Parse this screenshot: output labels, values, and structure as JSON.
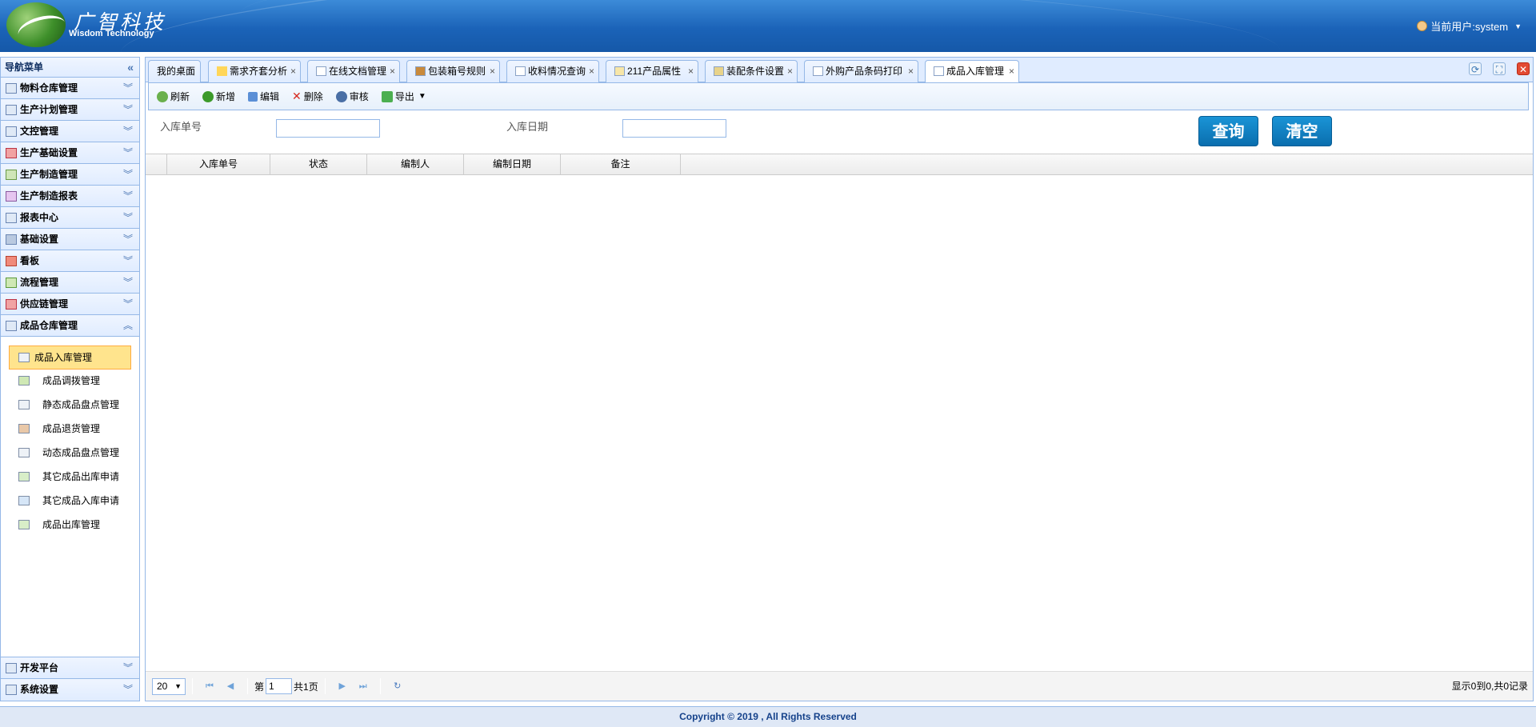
{
  "header": {
    "logo_cn": "广智科技",
    "logo_en": "Wisdom Technology",
    "user_label": "当前用户:system"
  },
  "sidebar": {
    "title": "导航菜单",
    "groups": [
      {
        "label": "物料仓库管理"
      },
      {
        "label": "生产计划管理"
      },
      {
        "label": "文控管理"
      },
      {
        "label": "生产基础设置"
      },
      {
        "label": "生产制造管理"
      },
      {
        "label": "生产制造报表"
      },
      {
        "label": "报表中心"
      },
      {
        "label": "基础设置"
      },
      {
        "label": "看板"
      },
      {
        "label": "流程管理"
      },
      {
        "label": "供应链管理"
      },
      {
        "label": "成品仓库管理"
      }
    ],
    "sub_items": [
      {
        "label": "成品入库管理"
      },
      {
        "label": "成品调拨管理"
      },
      {
        "label": "静态成品盘点管理"
      },
      {
        "label": "成品退货管理"
      },
      {
        "label": "动态成品盘点管理"
      },
      {
        "label": "其它成品出库申请"
      },
      {
        "label": "其它成品入库申请"
      },
      {
        "label": "成品出库管理"
      }
    ],
    "bottom_groups": [
      {
        "label": "开发平台"
      },
      {
        "label": "系统设置"
      }
    ]
  },
  "tabs": [
    {
      "label": "我的桌面"
    },
    {
      "label": "需求齐套分析"
    },
    {
      "label": "在线文档管理"
    },
    {
      "label": "包装箱号规则"
    },
    {
      "label": "收料情况查询"
    },
    {
      "label": "211产品属性"
    },
    {
      "label": "装配条件设置"
    },
    {
      "label": "外购产品条码打印"
    },
    {
      "label": "成品入库管理"
    }
  ],
  "toolbar": {
    "refresh": "刷新",
    "add": "新增",
    "edit": "编辑",
    "delete": "删除",
    "audit": "审核",
    "export": "导出"
  },
  "search": {
    "order_no_label": "入库单号",
    "order_no_value": "",
    "date_label": "入库日期",
    "date_value": "",
    "query_btn": "查询",
    "clear_btn": "清空"
  },
  "grid": {
    "columns": [
      "入库单号",
      "状态",
      "编制人",
      "编制日期",
      "备注"
    ],
    "rows": []
  },
  "pager": {
    "page_size": "20",
    "page_prefix": "第",
    "page_value": "1",
    "page_total": "共1页",
    "info": "显示0到0,共0记录"
  },
  "footer": {
    "copyright": "Copyright © 2019 , All Rights Reserved"
  },
  "colors": {
    "header_blue": "#1b63b8",
    "panel_border": "#95b8e7",
    "accent_button": "#0a6eae",
    "active_item": "#ffe48d"
  }
}
